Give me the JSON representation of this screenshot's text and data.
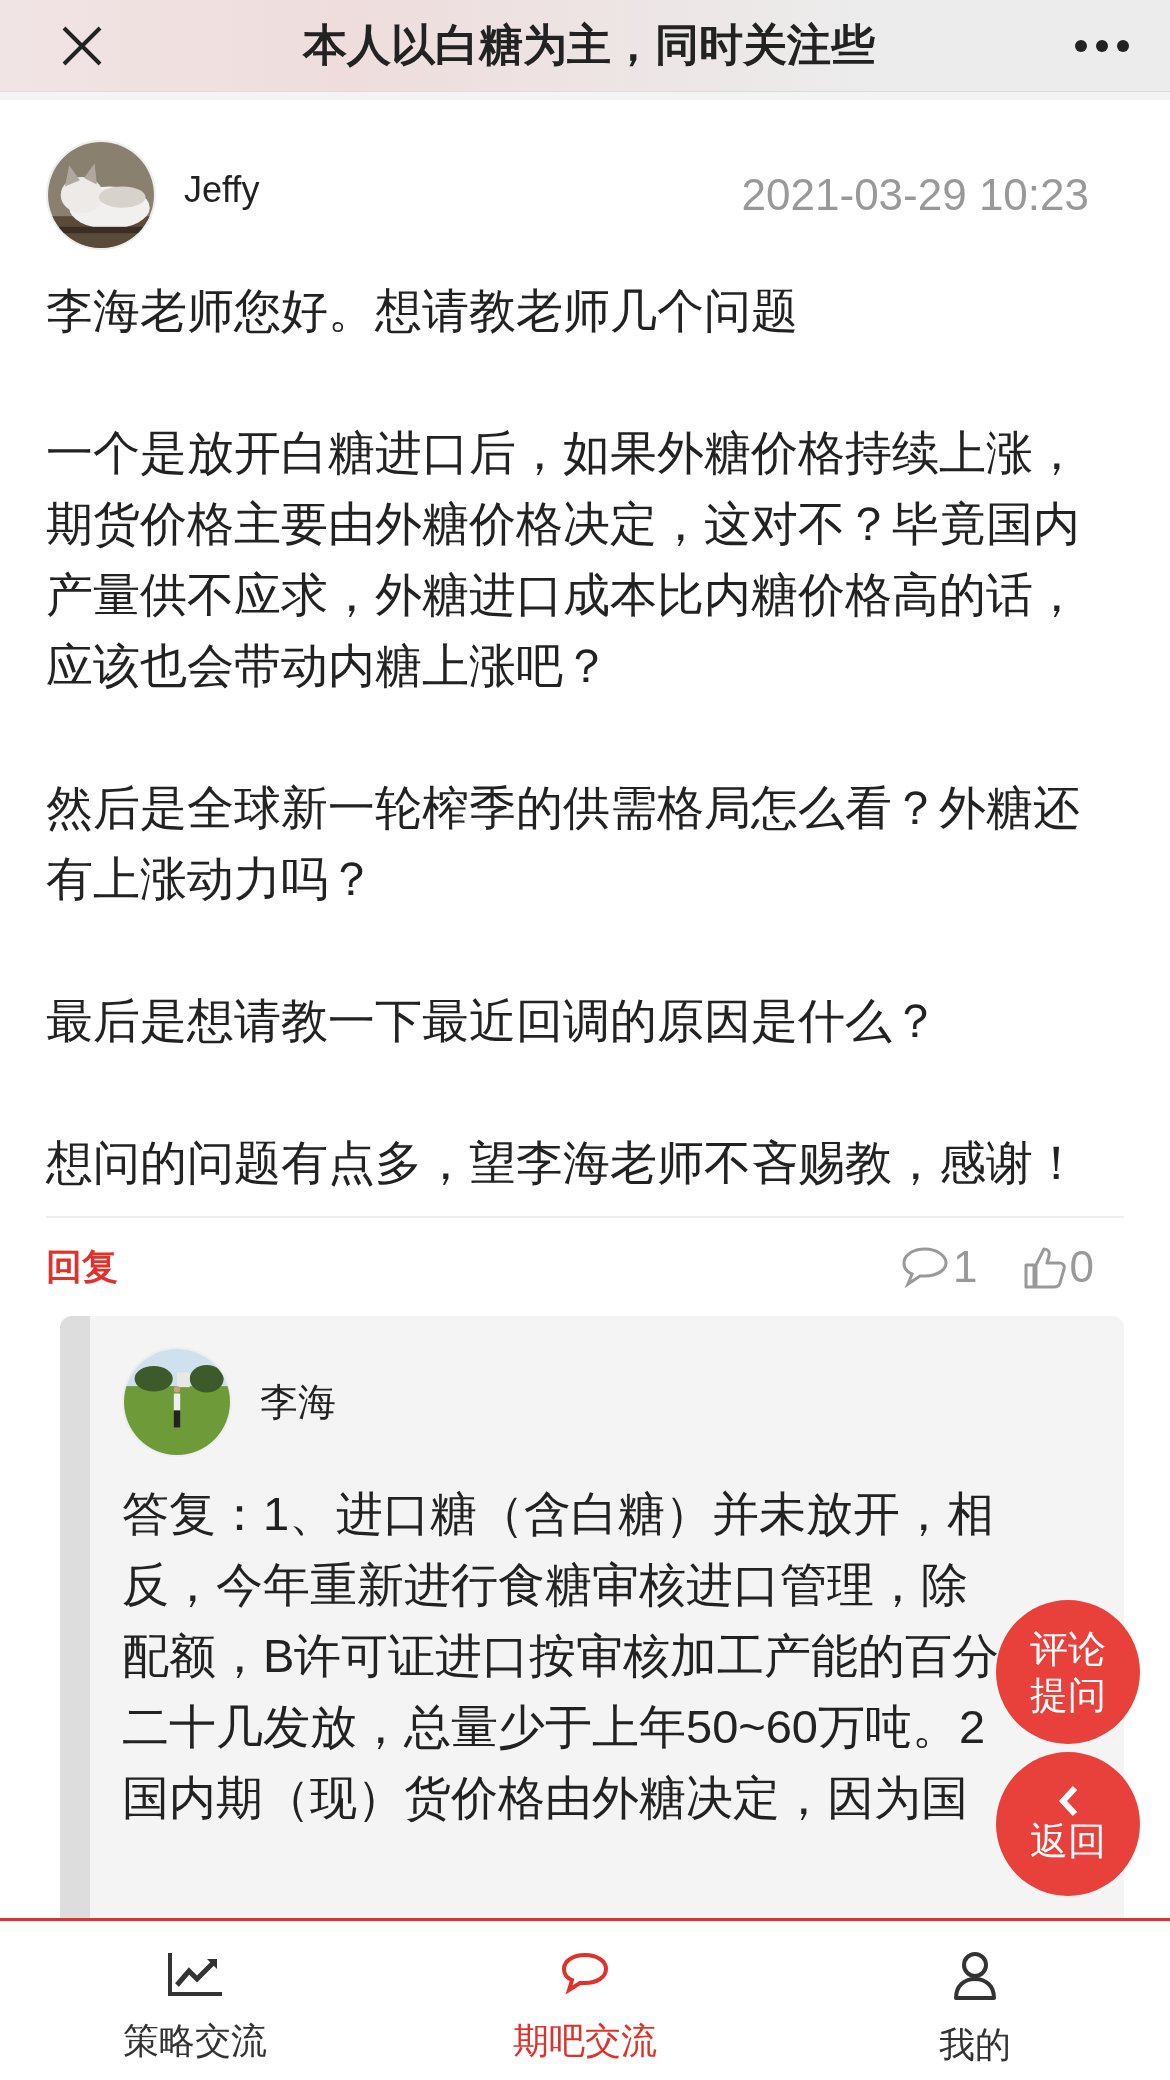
{
  "header": {
    "title": "本人以白糖为主，同时关注些"
  },
  "post": {
    "author": "Jeffy",
    "time": "2021-03-29 10:23",
    "paragraphs": [
      "李海老师您好。想请教老师几个问题",
      "一个是放开白糖进口后，如果外糖价格持续上涨，期货价格主要由外糖价格决定，这对不？毕竟国内产量供不应求，外糖进口成本比内糖价格高的话，应该也会带动内糖上涨吧？",
      "然后是全球新一轮榨季的供需格局怎么看？外糖还有上涨动力吗？",
      "最后是想请教一下最近回调的原因是什么？",
      "想问的问题有点多，望李海老师不吝赐教，感谢！"
    ],
    "reply_label": "回复",
    "comment_count": "1",
    "like_count": "0"
  },
  "reply": {
    "author": "李海",
    "lines": [
      "答复：1、进口糖（含白糖）并未放开，相",
      "反，今年重新进行食糖审核进口管理，除",
      "配额，B许可证进口按审核加工产能的百分",
      "二十几发放，总量少于上年50~60万吨。2",
      "国内期（现）货价格由外糖决定，因为国"
    ]
  },
  "floating_buttons": [
    {
      "kind": "comment",
      "label": "评论提问"
    },
    {
      "kind": "back",
      "label": "返回"
    }
  ],
  "nav": [
    {
      "kind": "chart",
      "label": "策略交流",
      "selected": false
    },
    {
      "kind": "chat",
      "label": "期吧交流",
      "selected": true
    },
    {
      "kind": "person",
      "label": "我的",
      "selected": false
    }
  ]
}
